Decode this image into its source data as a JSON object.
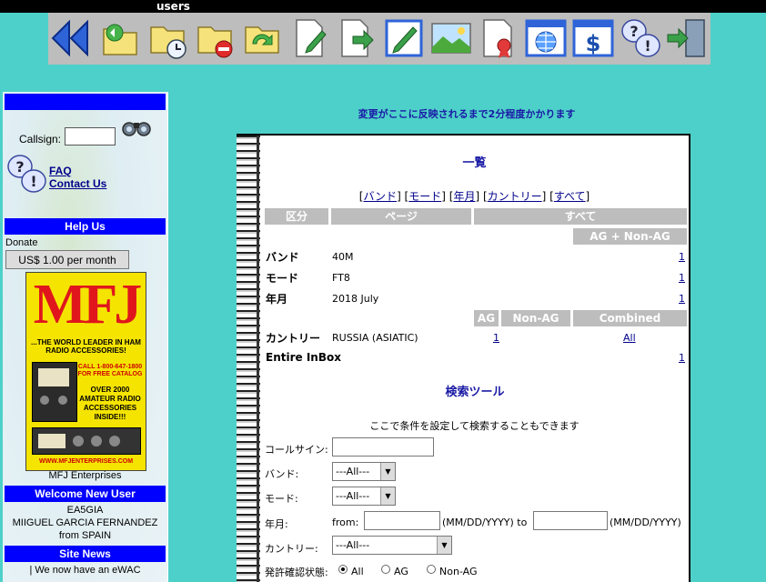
{
  "topbar": {
    "title": "users"
  },
  "sidebar": {
    "callsign_label": "Callsign:",
    "faq": "FAQ",
    "contact": "Contact Us",
    "help_us": "Help Us",
    "donate": "Donate",
    "donate_button": "US$ 1.00 per month",
    "ad": {
      "brand": "MFJ",
      "tagline": "...THE WORLD LEADER IN HAM RADIO ACCESSORIES!",
      "phone": "CALL 1-800-647-1800 FOR FREE CATALOG",
      "over": "OVER 2000 AMATEUR RADIO ACCESSORIES INSIDE!!!",
      "url": "WWW.MFJENTERPRISES.COM"
    },
    "ad_caption": "MFJ Enterprises",
    "welcome_title": "Welcome New User",
    "welcome_call": "EA5GIA",
    "welcome_name": "MIIGUEL GARCIA FERNANDEZ",
    "welcome_from": "from SPAIN",
    "news_title": "Site News",
    "news_text": "| We now have an eWAC"
  },
  "main": {
    "notice": "変更がここに反映されるまで2分程度かかります",
    "summary_title": "一覧",
    "filters": [
      "バンド",
      "モード",
      "年月",
      "カントリー",
      "すべて"
    ],
    "table_headers": [
      "区分",
      "ページ",
      "すべて"
    ],
    "ag_header": "AG + Non-AG",
    "rows": [
      {
        "label": "バンド",
        "value": "40M",
        "count": "1"
      },
      {
        "label": "モード",
        "value": "FT8",
        "count": "1"
      },
      {
        "label": "年月",
        "value": "2018 July",
        "count": "1"
      }
    ],
    "country_headers": [
      "AG",
      "Non-AG",
      "Combined"
    ],
    "country_row": {
      "label": "カントリー",
      "value": "RUSSIA (ASIATIC)",
      "ag": "1",
      "combined": "All"
    },
    "inbox_row": {
      "label": "Entire InBox",
      "count": "1"
    },
    "search_title": "検索ツール",
    "search_desc": "ここで条件を設定して検索することもできます",
    "search": {
      "callsign_label": "コールサイン:",
      "band_label": "バンド:",
      "band_value": "---All---",
      "mode_label": "モード:",
      "mode_value": "---All---",
      "date_label": "年月:",
      "date_from": "from:",
      "date_fmt1": "(MM/DD/YYYY) to",
      "date_fmt2": "(MM/DD/YYYY)",
      "country_label": "カントリー:",
      "country_value": "---All---",
      "qsl_label": "発許確認状態:",
      "qsl_options": [
        "All",
        "AG",
        "Non-AG"
      ]
    }
  }
}
